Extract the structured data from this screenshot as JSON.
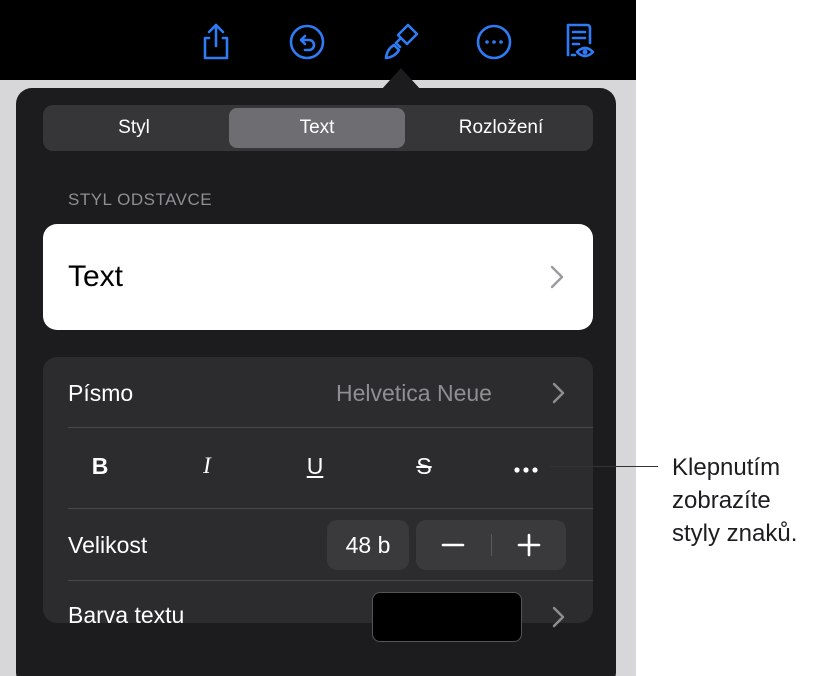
{
  "toolbar": {
    "icons": [
      "share-icon",
      "undo-icon",
      "format-brush-icon",
      "more-icon",
      "reading-view-icon"
    ],
    "accent_color": "#2f7bf5"
  },
  "tabs": [
    {
      "label": "Styl",
      "active": false
    },
    {
      "label": "Text",
      "active": true
    },
    {
      "label": "Rozložení",
      "active": false
    }
  ],
  "paragraph_style": {
    "header": "STYL ODSTAVCE",
    "value": "Text"
  },
  "font": {
    "label": "Písmo",
    "value": "Helvetica Neue"
  },
  "format_buttons": {
    "bold": "B",
    "italic": "I",
    "underline": "U",
    "strikethrough": "S",
    "more": "more-icon"
  },
  "size": {
    "label": "Velikost",
    "value": "48 b"
  },
  "text_color": {
    "label": "Barva textu",
    "color": "#000000"
  },
  "callout": {
    "lines": [
      "Klepnutím",
      "zobrazíte",
      "styly znaků."
    ]
  }
}
